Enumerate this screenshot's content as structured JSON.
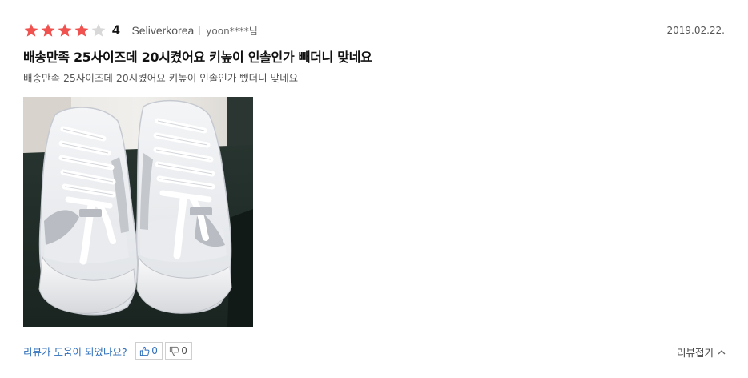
{
  "review": {
    "rating": 4,
    "rating_max": 5,
    "rating_label": "4",
    "seller": "Seliverkorea",
    "user": "yoon****님",
    "date": "2019.02.22.",
    "title": "배송만족 25사이즈데 20시켰어요 키높이 인솔인가 빼더니 맞네요",
    "body": "배송만족 25사이즈데 20시켰어요 키높이 인솔인가 뺐더니 맞네요"
  },
  "helpful": {
    "question": "리뷰가 도움이 되었나요?",
    "up_count": "0",
    "down_count": "0"
  },
  "fold_label": "리뷰접기",
  "colors": {
    "star_on": "#f0524f",
    "star_off": "#d8d8d8",
    "link": "#2f6fba"
  },
  "icons": {
    "star": "star-icon",
    "thumbs_up": "thumbs-up-icon",
    "thumbs_down": "thumbs-down-icon",
    "chevron": "chevron-up-icon"
  }
}
